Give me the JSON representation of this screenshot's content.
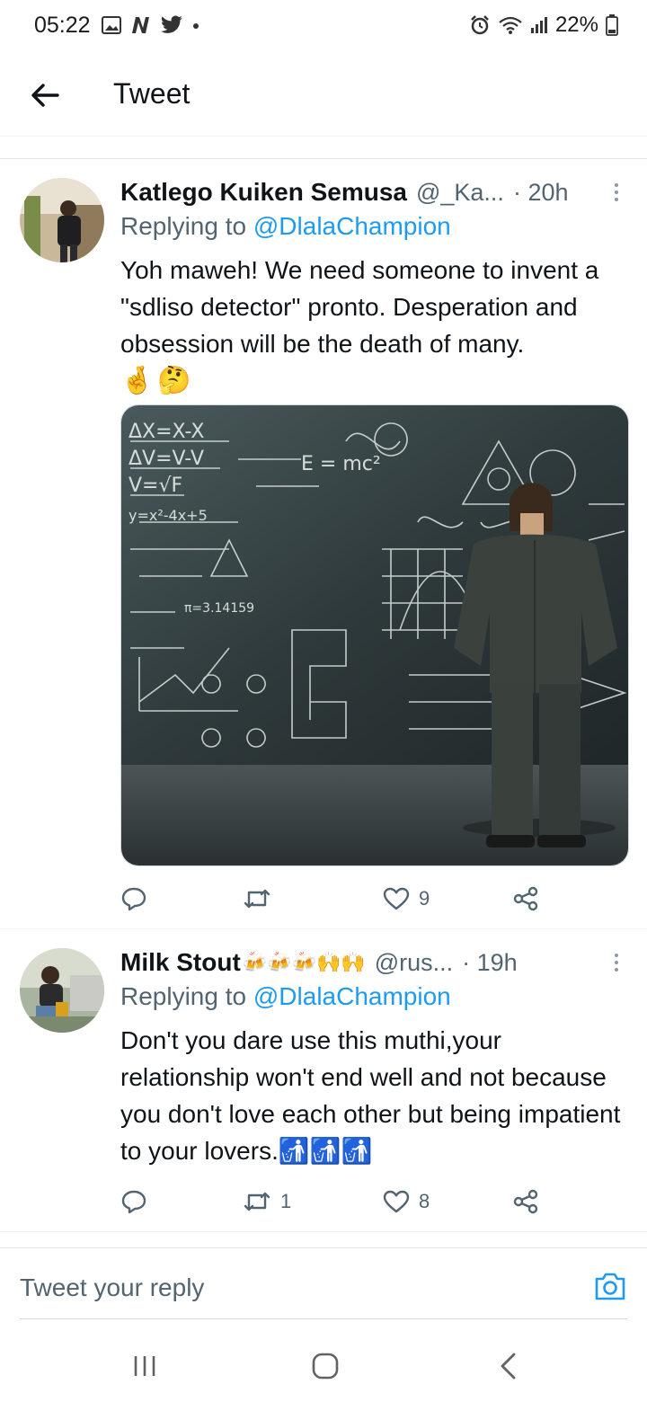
{
  "status_bar": {
    "time": "05:22",
    "battery": "22%",
    "icons_left": [
      "gallery-icon",
      "n-app-icon",
      "twitter-icon",
      "dot-icon"
    ],
    "icons_right": [
      "alarm-icon",
      "wifi-icon",
      "signal-icon",
      "battery-icon"
    ]
  },
  "header": {
    "title": "Tweet"
  },
  "tweets": [
    {
      "name": "Katlego Kuiken Semusa",
      "name_emojis": "",
      "handle": "@_Ka...",
      "time": "· 20h",
      "replying_prefix": "Replying to ",
      "replying_to": "@DlalaChampion",
      "text": "Yoh maweh! We need someone to invent a \"sdliso detector\" pronto. Desperation and obsession will be the death of many.",
      "emojis": "🤞🤔",
      "media_description": "Man in a suit looking at a chalkboard full of equations",
      "actions": {
        "reply": "",
        "retweet": "",
        "like": "9",
        "share": ""
      }
    },
    {
      "name": "Milk Stout",
      "name_emojis": "🍻🍻🍻🙌🙌",
      "handle": "@rus...",
      "time": "· 19h",
      "replying_prefix": "Replying to ",
      "replying_to": "@DlalaChampion",
      "text": "Don't you dare use this muthi,your relationship won't end well and not because you don't love each other but being impatient to your lovers.🚮🚮🚮",
      "emojis": "",
      "actions": {
        "reply": "",
        "retweet": "1",
        "like": "8",
        "share": ""
      }
    }
  ],
  "composer": {
    "placeholder": "Tweet your reply"
  },
  "colors": {
    "accent": "#1d9bf0",
    "text": "#0f1419",
    "muted": "#536471",
    "border": "#eff3f4"
  }
}
